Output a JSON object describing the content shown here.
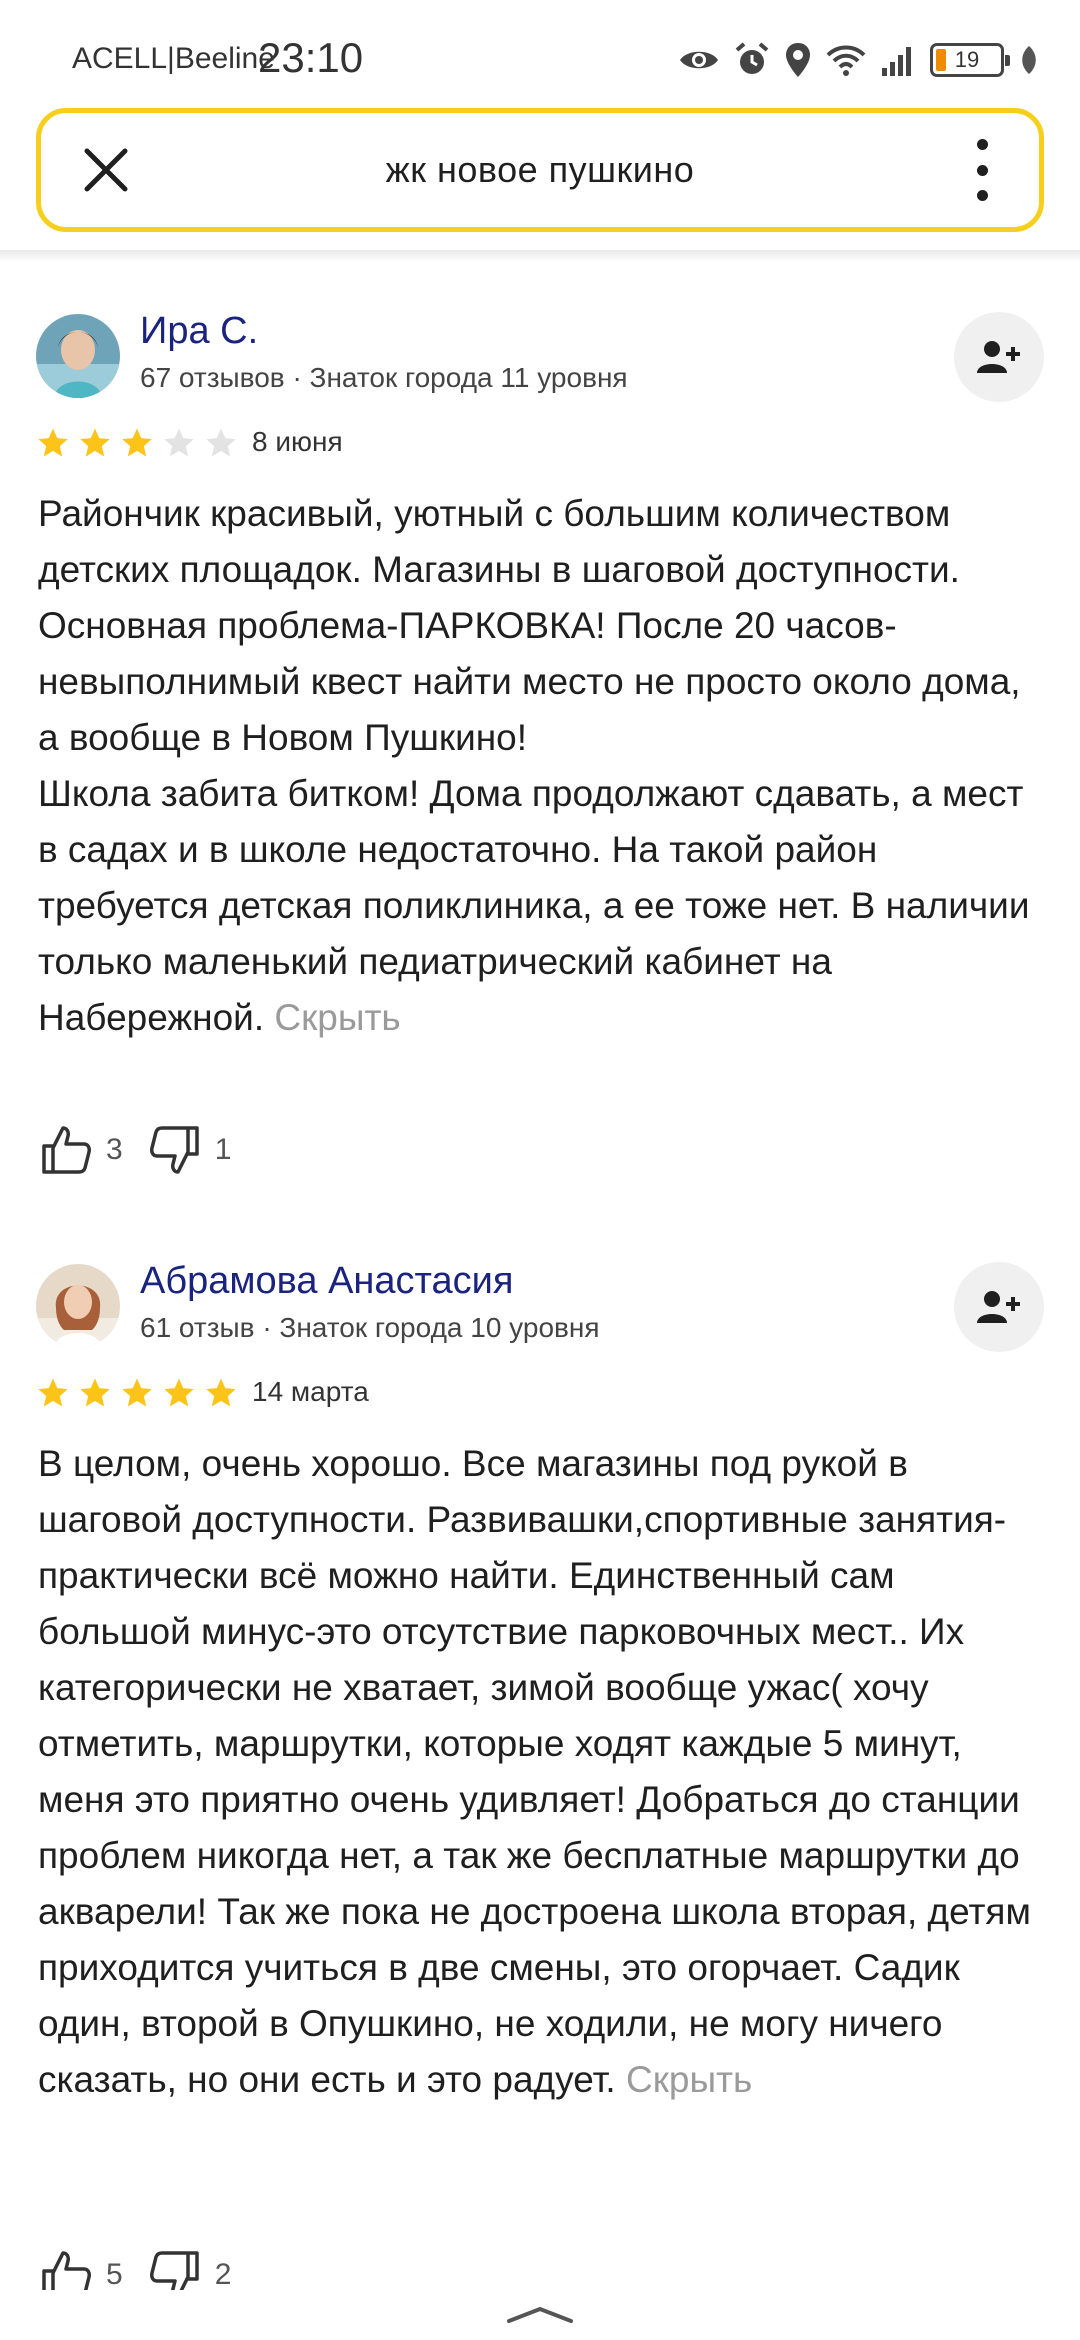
{
  "status_bar": {
    "carrier": "ACELL|Beeline",
    "time": "23:10",
    "battery": "19",
    "icons": [
      "eye-icon",
      "alarm-icon",
      "location-icon",
      "wifi-icon",
      "signal-icon",
      "battery-icon",
      "leaf-icon"
    ]
  },
  "search": {
    "query": "жк новое пушкино",
    "close_icon": "close-icon",
    "menu_icon": "more-vertical-icon"
  },
  "reviews": [
    {
      "author": "Ира С.",
      "meta": "67 отзывов · Знаток города 11 уровня",
      "rating": 3,
      "date": "8 июня",
      "text": "Райончик красивый, уютный с большим количеством детских площадок. Магазины в шаговой доступности.\nОсновная проблема-ПАРКОВКА! После 20 часов-невыполнимый квест найти место не просто около дома, а вообще в Новом Пушкино!\nШкола забита битком! Дома продолжают сдавать, а мест в садах и в школе недостаточно. На такой район требуется детская поликлиника, а ее тоже нет. В наличии только маленький педиатрический кабинет на Набережной. ",
      "hide_label": "Скрыть",
      "likes": "3",
      "dislikes": "1"
    },
    {
      "author": "Абрамова Анастасия",
      "meta": "61 отзыв · Знаток города 10 уровня",
      "rating": 5,
      "date": "14 марта",
      "text": "В целом, очень хорошо. Все магазины под рукой в шаговой доступности. Развивашки,спортивные занятия- практически всё можно найти. Единственный сам большой минус-это отсутствие парковочных мест.. Их категорически не хватает, зимой вообще ужас( хочу отметить, маршрутки, которые ходят каждые 5 минут, меня это приятно очень удивляет! Добраться до станции проблем никогда нет, а так же бесплатные маршрутки до акварели! Так же пока не достроена школа вторая, детям приходится учиться в две смены, это огорчает. Садик один, второй в Опушкино, не ходили, не могу ничего сказать, но они есть и это радует. ",
      "hide_label": "Скрыть",
      "likes": "5",
      "dislikes": "2"
    }
  ],
  "colors": {
    "accent_yellow": "#f5cf1b",
    "star_filled": "#fcc419",
    "star_empty": "#e3e3e3",
    "author_name": "#1a237e",
    "hide_link": "#9a9a9a"
  }
}
